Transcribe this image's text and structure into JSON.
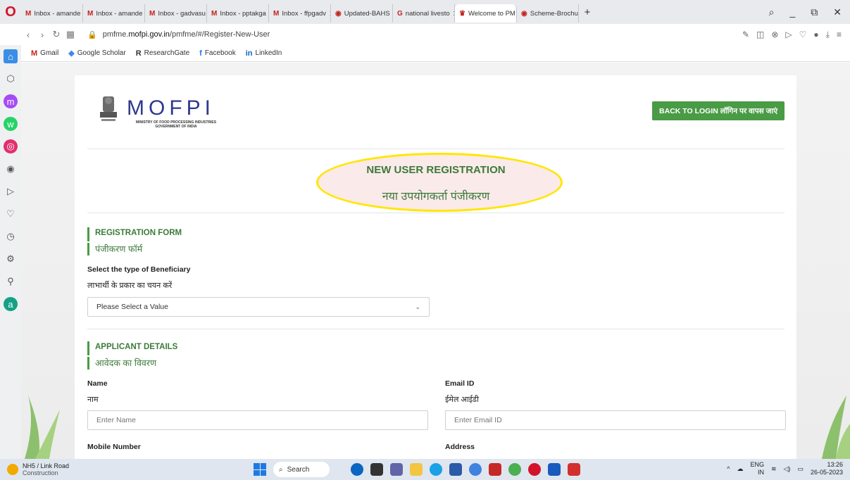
{
  "tabs": [
    {
      "label": "Inbox - amande",
      "icon": "M",
      "active": false
    },
    {
      "label": "Inbox - amande",
      "icon": "M",
      "active": false
    },
    {
      "label": "Inbox - gadvasu",
      "icon": "M",
      "active": false
    },
    {
      "label": "Inbox - pptakga",
      "icon": "M",
      "active": false
    },
    {
      "label": "Inbox - ffpgadv",
      "icon": "M",
      "active": false
    },
    {
      "label": "Updated-BAHS",
      "icon": "◉",
      "active": false
    },
    {
      "label": "national livesto",
      "icon": "G",
      "active": false
    },
    {
      "label": "Welcome to PM",
      "icon": "♛",
      "active": true
    },
    {
      "label": "Scheme-Brochu",
      "icon": "◉",
      "active": false
    }
  ],
  "address": {
    "url_prefix": "pmfme.",
    "url_domain": "mofpi.gov.in",
    "url_path": "/pmfme/#/Register-New-User"
  },
  "bookmarks": [
    {
      "label": "Gmail",
      "icon": "M"
    },
    {
      "label": "Google Scholar",
      "icon": "◆"
    },
    {
      "label": "ResearchGate",
      "icon": "R"
    },
    {
      "label": "Facebook",
      "icon": "f"
    },
    {
      "label": "LinkedIn",
      "icon": "in"
    }
  ],
  "header": {
    "logo_text": "MOFPI",
    "logo_sub_1": "MINISTRY OF FOOD PROCESSING INDUSTRIES",
    "logo_sub_2": "GOVERNMENT OF INDIA",
    "back_button": "BACK TO LOGIN लॉगिन पर वापस जाएं"
  },
  "title": {
    "en": "NEW USER REGISTRATION",
    "hi": "नया उपयोगकर्ता पंजीकरण"
  },
  "registration_form": {
    "heading_en": "REGISTRATION FORM",
    "heading_hi": "पंजीकरण फॉर्म",
    "beneficiary_label_en": "Select the type of Beneficiary",
    "beneficiary_label_hi": "लाभार्थी के प्रकार का चयन करें",
    "beneficiary_value": "Please Select a Value"
  },
  "applicant": {
    "heading_en": "APPLICANT DETAILS",
    "heading_hi": "आवेदक का विवरण",
    "name_label_en": "Name",
    "name_label_hi": "नाम",
    "name_placeholder": "Enter Name",
    "email_label_en": "Email ID",
    "email_label_hi": "ईमेल आईडी",
    "email_placeholder": "Enter Email ID",
    "mobile_label_en": "Mobile Number",
    "address_label_en": "Address"
  },
  "taskbar": {
    "weather_line1": "NH5 / Link Road",
    "weather_line2": "Construction",
    "search_label": "Search",
    "lang_line1": "ENG",
    "lang_line2": "IN",
    "time": "13:26",
    "date": "26-05-2023"
  },
  "colors": {
    "accent_green": "#4a9b45",
    "title_green": "#3c7a3a",
    "highlight_yellow": "#ffe600"
  }
}
